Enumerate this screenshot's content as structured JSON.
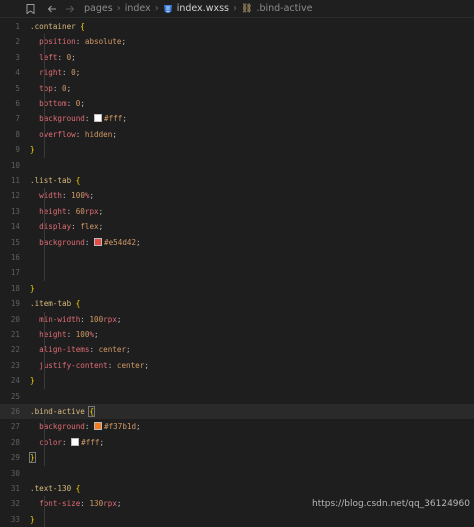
{
  "breadcrumb": {
    "items": [
      "pages",
      "index",
      "index.wxss",
      ".bind-active"
    ]
  },
  "colors": {
    "white": "#fff",
    "red": "#e54d42",
    "orange": "#f37b1d"
  },
  "lines": [
    {
      "n": "1",
      "parts": [
        {
          "t": ".container ",
          "c": "sel"
        },
        {
          "t": "{",
          "c": "brace"
        }
      ]
    },
    {
      "n": "2",
      "parts": [
        {
          "t": "  position",
          "c": "prop"
        },
        {
          "t": ": ",
          "c": "punc"
        },
        {
          "t": "absolute",
          "c": "val"
        },
        {
          "t": ";",
          "c": "punc"
        }
      ]
    },
    {
      "n": "3",
      "parts": [
        {
          "t": "  left",
          "c": "prop"
        },
        {
          "t": ": ",
          "c": "punc"
        },
        {
          "t": "0",
          "c": "num"
        },
        {
          "t": ";",
          "c": "punc"
        }
      ]
    },
    {
      "n": "4",
      "parts": [
        {
          "t": "  right",
          "c": "prop"
        },
        {
          "t": ": ",
          "c": "punc"
        },
        {
          "t": "0",
          "c": "num"
        },
        {
          "t": ";",
          "c": "punc"
        }
      ]
    },
    {
      "n": "5",
      "parts": [
        {
          "t": "  top",
          "c": "prop"
        },
        {
          "t": ": ",
          "c": "punc"
        },
        {
          "t": "0",
          "c": "num"
        },
        {
          "t": ";",
          "c": "punc"
        }
      ]
    },
    {
      "n": "6",
      "parts": [
        {
          "t": "  bottom",
          "c": "prop"
        },
        {
          "t": ": ",
          "c": "punc"
        },
        {
          "t": "0",
          "c": "num"
        },
        {
          "t": ";",
          "c": "punc"
        }
      ]
    },
    {
      "n": "7",
      "parts": [
        {
          "t": "  background",
          "c": "prop"
        },
        {
          "t": ": ",
          "c": "punc"
        },
        {
          "sw": "#fff"
        },
        {
          "t": "#fff",
          "c": "val"
        },
        {
          "t": ";",
          "c": "punc"
        }
      ]
    },
    {
      "n": "8",
      "parts": [
        {
          "t": "  overflow",
          "c": "prop"
        },
        {
          "t": ": ",
          "c": "punc"
        },
        {
          "t": "hidden",
          "c": "val"
        },
        {
          "t": ";",
          "c": "punc"
        }
      ]
    },
    {
      "n": "9",
      "parts": [
        {
          "t": "}",
          "c": "brace"
        }
      ]
    },
    {
      "n": "10",
      "parts": []
    },
    {
      "n": "11",
      "parts": [
        {
          "t": ".list-tab ",
          "c": "sel"
        },
        {
          "t": "{",
          "c": "brace"
        }
      ]
    },
    {
      "n": "12",
      "parts": [
        {
          "t": "  width",
          "c": "prop"
        },
        {
          "t": ": ",
          "c": "punc"
        },
        {
          "t": "100",
          "c": "num"
        },
        {
          "t": "%",
          "c": "unit"
        },
        {
          "t": ";",
          "c": "punc"
        }
      ]
    },
    {
      "n": "13",
      "parts": [
        {
          "t": "  height",
          "c": "prop"
        },
        {
          "t": ": ",
          "c": "punc"
        },
        {
          "t": "60",
          "c": "num"
        },
        {
          "t": "rpx",
          "c": "unit"
        },
        {
          "t": ";",
          "c": "punc"
        }
      ]
    },
    {
      "n": "14",
      "parts": [
        {
          "t": "  display",
          "c": "prop"
        },
        {
          "t": ": ",
          "c": "punc"
        },
        {
          "t": "flex",
          "c": "val"
        },
        {
          "t": ";",
          "c": "punc"
        }
      ]
    },
    {
      "n": "15",
      "parts": [
        {
          "t": "  background",
          "c": "prop"
        },
        {
          "t": ": ",
          "c": "punc"
        },
        {
          "sw": "#e54d42"
        },
        {
          "t": "#e54d42",
          "c": "val"
        },
        {
          "t": ";",
          "c": "punc"
        }
      ]
    },
    {
      "n": "16",
      "parts": []
    },
    {
      "n": "17",
      "parts": []
    },
    {
      "n": "18",
      "parts": [
        {
          "t": "}",
          "c": "brace"
        }
      ]
    },
    {
      "n": "19",
      "parts": [
        {
          "t": ".item-tab ",
          "c": "sel"
        },
        {
          "t": "{",
          "c": "brace"
        }
      ]
    },
    {
      "n": "20",
      "parts": [
        {
          "t": "  min-width",
          "c": "prop"
        },
        {
          "t": ": ",
          "c": "punc"
        },
        {
          "t": "100",
          "c": "num"
        },
        {
          "t": "rpx",
          "c": "unit"
        },
        {
          "t": ";",
          "c": "punc"
        }
      ]
    },
    {
      "n": "21",
      "parts": [
        {
          "t": "  height",
          "c": "prop"
        },
        {
          "t": ": ",
          "c": "punc"
        },
        {
          "t": "100",
          "c": "num"
        },
        {
          "t": "%",
          "c": "unit"
        },
        {
          "t": ";",
          "c": "punc"
        }
      ]
    },
    {
      "n": "22",
      "parts": [
        {
          "t": "  align-items",
          "c": "prop"
        },
        {
          "t": ": ",
          "c": "punc"
        },
        {
          "t": "center",
          "c": "val"
        },
        {
          "t": ";",
          "c": "punc"
        }
      ]
    },
    {
      "n": "23",
      "parts": [
        {
          "t": "  justify-content",
          "c": "prop"
        },
        {
          "t": ": ",
          "c": "punc"
        },
        {
          "t": "center",
          "c": "val"
        },
        {
          "t": ";",
          "c": "punc"
        }
      ]
    },
    {
      "n": "24",
      "parts": [
        {
          "t": "}",
          "c": "brace"
        }
      ]
    },
    {
      "n": "25",
      "parts": []
    },
    {
      "n": "26",
      "parts": [
        {
          "t": ".bind-active ",
          "c": "sel"
        },
        {
          "t": "{",
          "c": "brace",
          "box": true
        }
      ],
      "hl": true
    },
    {
      "n": "27",
      "parts": [
        {
          "t": "  background",
          "c": "prop"
        },
        {
          "t": ": ",
          "c": "punc"
        },
        {
          "sw": "#f37b1d"
        },
        {
          "t": "#f37b1d",
          "c": "val"
        },
        {
          "t": ";",
          "c": "punc"
        }
      ]
    },
    {
      "n": "28",
      "parts": [
        {
          "t": "  color",
          "c": "prop"
        },
        {
          "t": ": ",
          "c": "punc"
        },
        {
          "sw": "#fff"
        },
        {
          "t": "#fff",
          "c": "val"
        },
        {
          "t": ";",
          "c": "punc"
        }
      ]
    },
    {
      "n": "29",
      "parts": [
        {
          "t": "}",
          "c": "brace",
          "box": true
        }
      ]
    },
    {
      "n": "30",
      "parts": []
    },
    {
      "n": "31",
      "parts": [
        {
          "t": ".text-130 ",
          "c": "sel"
        },
        {
          "t": "{",
          "c": "brace"
        }
      ]
    },
    {
      "n": "32",
      "parts": [
        {
          "t": "  font-size",
          "c": "prop"
        },
        {
          "t": ": ",
          "c": "punc"
        },
        {
          "t": "130",
          "c": "num"
        },
        {
          "t": "rpx",
          "c": "unit"
        },
        {
          "t": ";",
          "c": "punc"
        }
      ]
    },
    {
      "n": "33",
      "parts": [
        {
          "t": "}",
          "c": "brace"
        }
      ]
    }
  ],
  "watermark": "https://blog.csdn.net/qq_36124960"
}
